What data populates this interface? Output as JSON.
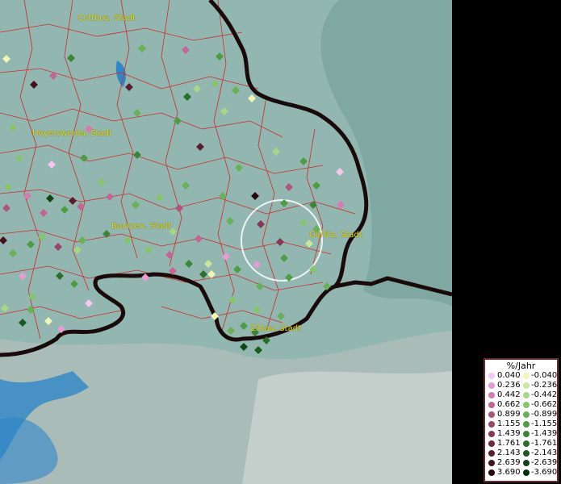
{
  "map": {
    "cities": [
      {
        "id": "cottbus",
        "label": "Cottbus, Stadt"
      },
      {
        "id": "hoyerswerda",
        "label": "Hoyerswerda, Stadt"
      },
      {
        "id": "bautzen",
        "label": "Bautzen, Stadt"
      },
      {
        "id": "goerlitz",
        "label": "Görlitz, Stadt"
      },
      {
        "id": "zittau",
        "label": "Zittau, Stadt"
      }
    ],
    "colors": {
      "district_lines": "#d22a2a",
      "border": "#1a0a0a",
      "rivers": "#2f86c8",
      "highlight_circle": "#ffffff",
      "city_label": "#e6e000"
    }
  },
  "legend": {
    "title": "%/Jahr",
    "positive": [
      {
        "label": "0.040",
        "color": "#f7c5ee"
      },
      {
        "label": "0.236",
        "color": "#e89ad3"
      },
      {
        "label": "0.442",
        "color": "#d67ab2"
      },
      {
        "label": "0.662",
        "color": "#c46596"
      },
      {
        "label": "0.899",
        "color": "#b0547e"
      },
      {
        "label": "1.155",
        "color": "#9c4568"
      },
      {
        "label": "1.439",
        "color": "#883754"
      },
      {
        "label": "1.761",
        "color": "#722a40"
      },
      {
        "label": "2.143",
        "color": "#5c1d2e"
      },
      {
        "label": "2.639",
        "color": "#44121e"
      },
      {
        "label": "3.690",
        "color": "#2a0710"
      }
    ],
    "negative": [
      {
        "label": "-0.040",
        "color": "#f0f7b5"
      },
      {
        "label": "-0.236",
        "color": "#c9e89a"
      },
      {
        "label": "-0.442",
        "color": "#a6d784"
      },
      {
        "label": "-0.662",
        "color": "#86c56c"
      },
      {
        "label": "-0.899",
        "color": "#68b156"
      },
      {
        "label": "-1.155",
        "color": "#4e9c44"
      },
      {
        "label": "-1.439",
        "color": "#3a8636"
      },
      {
        "label": "-1.761",
        "color": "#2a6f2a"
      },
      {
        "label": "-2.143",
        "color": "#1c5a20"
      },
      {
        "label": "-2.639",
        "color": "#104517"
      },
      {
        "label": "-3.690",
        "color": "#06300e"
      }
    ]
  }
}
